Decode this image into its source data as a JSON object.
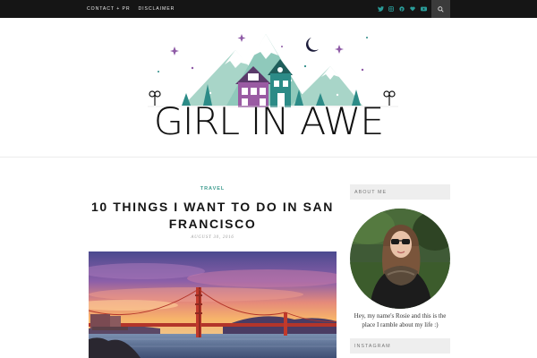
{
  "topbar": {
    "nav": [
      "CONTACT + PR",
      "DISCLAIMER"
    ],
    "social_icons": [
      "twitter-icon",
      "instagram-icon",
      "pinterest-icon",
      "heart-icon",
      "youtube-icon"
    ],
    "social_color": "#2a9d9a",
    "search_icon": "search-icon"
  },
  "header": {
    "site_title": "GIRL IN AWE",
    "logo_colors": {
      "mountain": "#a8d5c8",
      "house_purple": "#9a5ba3",
      "house_teal": "#2c8b87",
      "star": "#8e5aa6",
      "tree": "#2c8b87",
      "moon": "#1d1d3b"
    }
  },
  "post": {
    "category": "TRAVEL",
    "title": "10 THINGS I WANT TO DO IN SAN FRANCISCO",
    "date": "AUGUST 30, 2016",
    "image_subject": "golden-gate-bridge-sunset"
  },
  "sidebar": {
    "about_title": "ABOUT ME",
    "about_text": "Hey, my name's Rosie and this is the place I ramble about my life :)",
    "instagram_title": "INSTAGRAM"
  },
  "colors": {
    "accent": "#3d9b8e",
    "topbar": "#151515"
  }
}
